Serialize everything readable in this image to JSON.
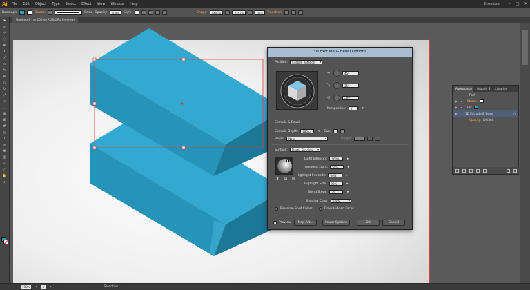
{
  "app": {
    "logo": "Ai",
    "menus": [
      "File",
      "Edit",
      "Object",
      "Type",
      "Select",
      "Effect",
      "View",
      "Window",
      "Help"
    ],
    "workspace": "Essentials",
    "window_buttons": [
      "–",
      "▢",
      "✕"
    ]
  },
  "controlbar": {
    "tool_label": "Rectangle",
    "stroke_label": "Stroke:",
    "stroke_style": "Basic",
    "opacity_label": "Opacity:",
    "opacity_value": "100%",
    "style_label": "Style:",
    "shape_label": "Shape:",
    "width_value": "440 px",
    "height_value": "326 px",
    "corner_value": "0 px",
    "transform_label": "Transform",
    "fill_color": "#29a0c6"
  },
  "document": {
    "tab_title": "Untitled-1* @ 100% (RGB/GPU Preview)"
  },
  "status": {
    "zoom": "100%",
    "page": "1",
    "tool": "Selection"
  },
  "dialog": {
    "title": "3D Extrude & Bevel Options",
    "position_label": "Position:",
    "position_value": "Custom Rotation",
    "rot_x": "45°",
    "rot_y": "35°",
    "rot_z": "-30°",
    "perspective_label": "Perspective:",
    "perspective_value": "0°",
    "section_extrude": "Extrude & Bevel",
    "depth_label": "Extrude Depth:",
    "depth_value": "180 pt",
    "cap_label": "Cap:",
    "bevel_label": "Bevel:",
    "bevel_value": "None",
    "height_label": "Height:",
    "height_value": "4 pt",
    "surface_label": "Surface:",
    "surface_value": "Plastic Shading",
    "light_intensity_label": "Light Intensity:",
    "light_intensity_value": "100%",
    "ambient_label": "Ambient Light:",
    "ambient_value": "50%",
    "highlight_intensity_label": "Highlight Intensity:",
    "highlight_intensity_value": "60%",
    "highlight_size_label": "Highlight Size:",
    "highlight_size_value": "90%",
    "blend_steps_label": "Blend Steps:",
    "blend_steps_value": "25",
    "shading_color_label": "Shading Color:",
    "shading_color_value": "Black",
    "preserve_spot_label": "Preserve Spot Colors",
    "draw_hidden_label": "Draw Hidden Faces",
    "preview_label": "Preview",
    "map_art_label": "Map Art...",
    "fewer_options_label": "Fewer Options",
    "ok_label": "OK",
    "cancel_label": "Cancel"
  },
  "appearance": {
    "tabs": [
      "Appearance",
      "Graphic S",
      "Libraries"
    ],
    "object": "Path",
    "stroke_label": "Stroke:",
    "fill_label": "Fill:",
    "effect_label": "3D Extrude & Bevel",
    "effect_fx": "fx",
    "opacity_label": "Opacity:",
    "opacity_value": "Default"
  },
  "colors": {
    "shape_top": "#33a9d2",
    "shape_front": "#258fb3",
    "shape_side": "#1d7797",
    "selection": "#e23a3a"
  }
}
